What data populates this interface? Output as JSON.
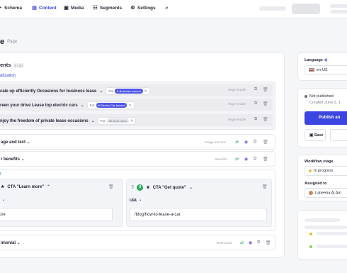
{
  "nav": {
    "items": [
      {
        "label": "Schema",
        "icon": "schema-icon",
        "active": false
      },
      {
        "label": "Content",
        "icon": "content-icon",
        "active": true
      },
      {
        "label": "Media",
        "icon": "media-icon",
        "active": false
      },
      {
        "label": "Segments",
        "icon": "segments-icon",
        "active": false
      },
      {
        "label": "Settings",
        "icon": "settings-icon",
        "active": false
      }
    ],
    "search_icon": "search-icon"
  },
  "page": {
    "title": "e",
    "tag": "Page"
  },
  "components": {
    "title": "ents",
    "count": "5 / 30",
    "personalization_label": "alization",
    "personalized_rows": [
      {
        "title": "cale up efficiently Occasions for business lease",
        "for": "For",
        "audience": "Business owners",
        "audience_style": "primary",
        "type": "Page header"
      },
      {
        "title": "reen your drive Lease top electric cars",
        "for": "For",
        "audience": "Electric Car lessors",
        "audience_style": "primary",
        "type": "Page header"
      },
      {
        "title": "njoy the freedom of private lease occasions",
        "for": "For",
        "audience": "All other users",
        "audience_style": "muted",
        "type": "Page header"
      }
    ],
    "blocks": [
      {
        "title": "age and text",
        "type": "Image and text"
      },
      {
        "title": "r benefits",
        "type": "Benefits"
      }
    ],
    "cta": {
      "label": "t",
      "left": {
        "title": "CTA \"Learn more\"",
        "field_label": "",
        "field_value": "more"
      },
      "right": {
        "number": "8",
        "title": "CTA \"Get quote\"",
        "field_label": "URL",
        "field_value": "/blog/how-to-lease-a-car"
      }
    },
    "testimonial": {
      "title": "imonial",
      "type": "Testimonial"
    }
  },
  "sidebar": {
    "language_label": "Language",
    "language_value": "en-US",
    "status": "Not published",
    "created": "Created June 2, 1",
    "publish_label": "Publish an",
    "save_label": "Save",
    "workflow_label": "Workflow stage",
    "workflow_value": "In progress",
    "assigned_label": "Assigned to",
    "assigned_value": "Labeeba Al Am"
  },
  "colors": {
    "accent": "#3b45e0",
    "green": "#27a85a",
    "amber": "#f5b82e",
    "lime": "#8fd14f"
  }
}
